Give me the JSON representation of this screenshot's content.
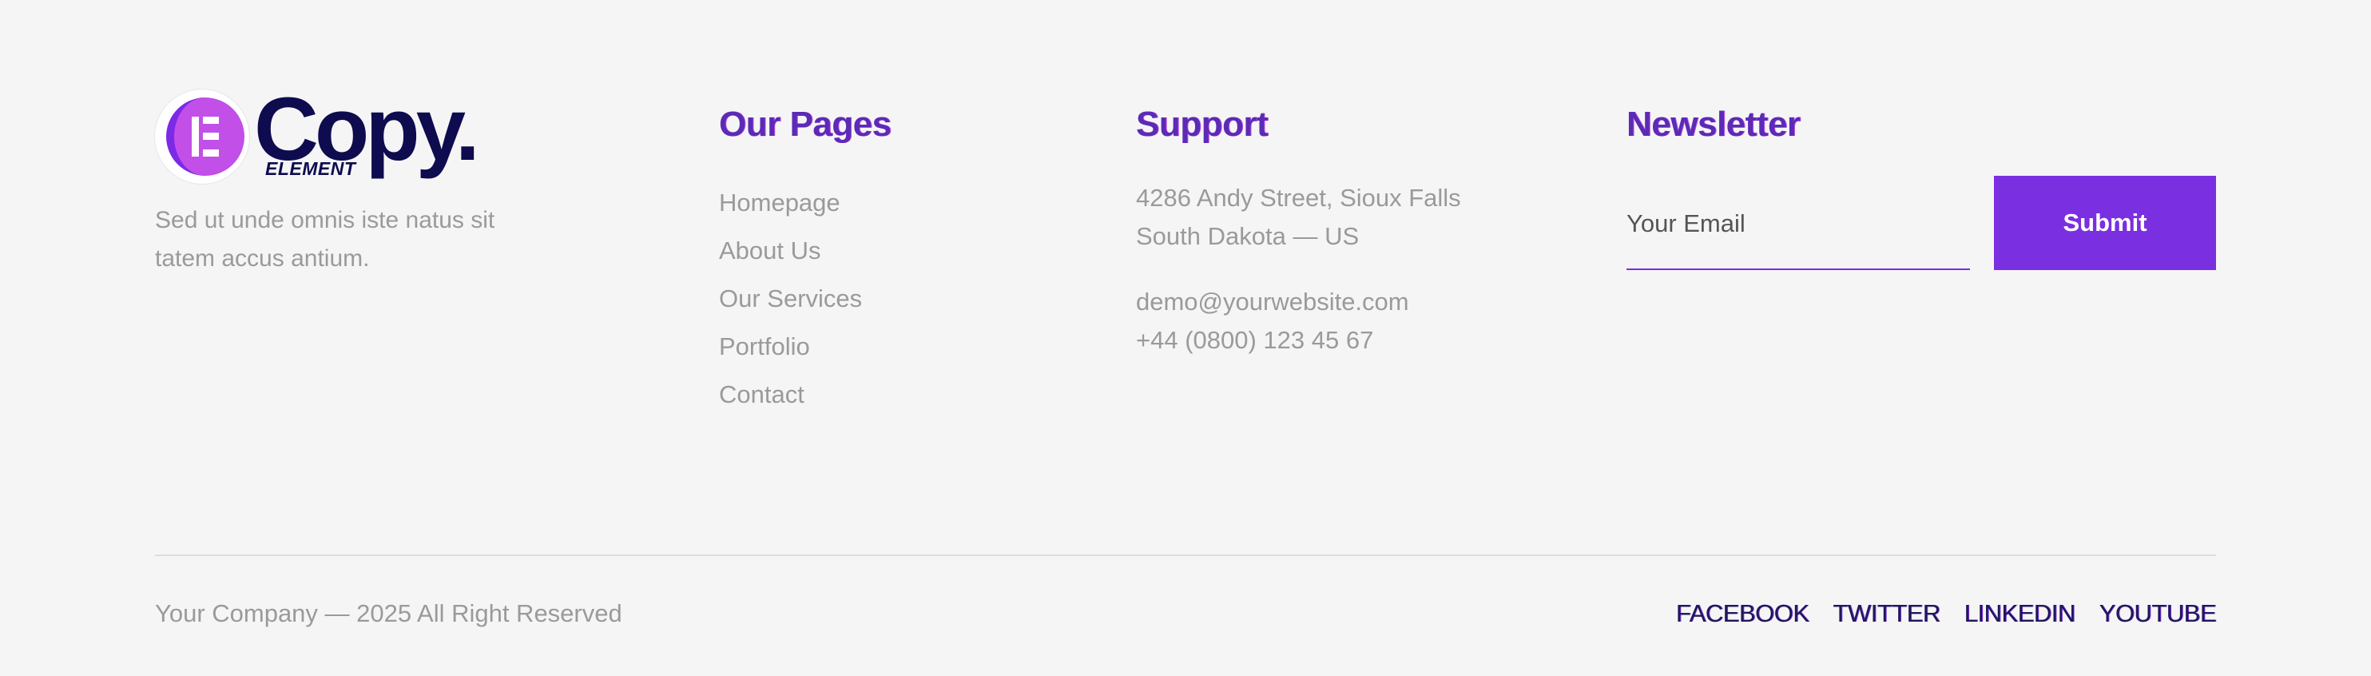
{
  "brand": {
    "logo_word": "Copy.",
    "logo_sub": "ELEMENT",
    "logo_icon": "elementor-e-icon",
    "description": "Sed ut unde omnis iste natus sit tatem accus antium."
  },
  "pages": {
    "title": "Our Pages",
    "links": [
      "Homepage",
      "About Us",
      "Our Services",
      "Portfolio",
      "Contact"
    ]
  },
  "support": {
    "title": "Support",
    "address_line1": "4286 Andy Street, Sioux Falls",
    "address_line2": "South Dakota — US",
    "email": "demo@yourwebsite.com",
    "phone": "+44 (0800) 123 45 67"
  },
  "newsletter": {
    "title": "Newsletter",
    "placeholder": "Your Email",
    "button_label": "Submit"
  },
  "bottom": {
    "copyright": "Your Company — 2025 All Right Reserved",
    "social": [
      "FACEBOOK",
      "TWITTER",
      "LINKEDIN",
      "YOUTUBE"
    ]
  },
  "colors": {
    "accent": "#7a2fe0",
    "heading": "#5b2bb6",
    "logo_dark": "#0e0b4f",
    "background": "#f5f5f5"
  }
}
